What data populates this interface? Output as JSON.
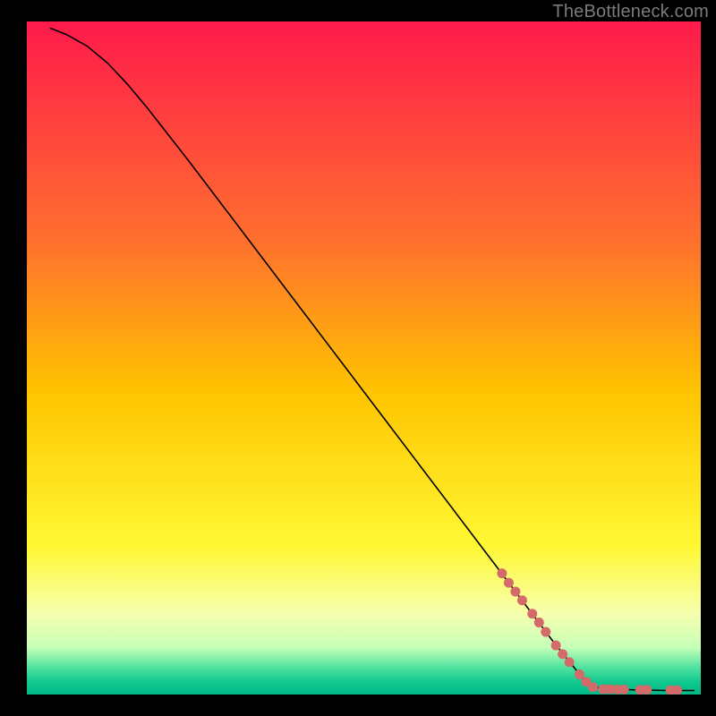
{
  "watermark": "TheBottleneck.com",
  "chart_data": {
    "type": "line",
    "title": "",
    "xlabel": "",
    "ylabel": "",
    "xlim": [
      0,
      100
    ],
    "ylim": [
      0,
      100
    ],
    "grid": false,
    "background_gradient": {
      "stops": [
        {
          "offset": 0.0,
          "color": "#ff1a4b"
        },
        {
          "offset": 0.32,
          "color": "#ff6e2f"
        },
        {
          "offset": 0.55,
          "color": "#ffc400"
        },
        {
          "offset": 0.78,
          "color": "#fff833"
        },
        {
          "offset": 0.88,
          "color": "#f7ffae"
        },
        {
          "offset": 0.93,
          "color": "#c6ffb8"
        },
        {
          "offset": 0.96,
          "color": "#4fe3a0"
        },
        {
          "offset": 0.98,
          "color": "#13c98f"
        },
        {
          "offset": 1.0,
          "color": "#00b888"
        }
      ]
    },
    "series": [
      {
        "name": "bottleneck-curve",
        "stroke": "#000000",
        "stroke_width": 1.6,
        "points": [
          {
            "x": 3.5,
            "y": 99.0
          },
          {
            "x": 6.0,
            "y": 98.0
          },
          {
            "x": 9.0,
            "y": 96.3
          },
          {
            "x": 12.0,
            "y": 93.8
          },
          {
            "x": 15.0,
            "y": 90.6
          },
          {
            "x": 18.0,
            "y": 87.0
          },
          {
            "x": 24.0,
            "y": 79.3
          },
          {
            "x": 30.0,
            "y": 71.4
          },
          {
            "x": 40.0,
            "y": 58.2
          },
          {
            "x": 50.0,
            "y": 45.0
          },
          {
            "x": 60.0,
            "y": 31.8
          },
          {
            "x": 70.0,
            "y": 18.6
          },
          {
            "x": 78.0,
            "y": 8.0
          },
          {
            "x": 82.5,
            "y": 2.4
          },
          {
            "x": 84.0,
            "y": 1.2
          },
          {
            "x": 86.0,
            "y": 0.8
          },
          {
            "x": 90.0,
            "y": 0.7
          },
          {
            "x": 95.0,
            "y": 0.6
          },
          {
            "x": 99.0,
            "y": 0.6
          }
        ]
      }
    ],
    "dotted_overlay": {
      "name": "highlighted-segment",
      "color": "#d46a6a",
      "radius": 5.5,
      "dots": [
        {
          "x": 70.5,
          "y": 18.0
        },
        {
          "x": 71.5,
          "y": 16.6
        },
        {
          "x": 72.5,
          "y": 15.3
        },
        {
          "x": 73.5,
          "y": 14.0
        },
        {
          "x": 75.0,
          "y": 12.0
        },
        {
          "x": 76.0,
          "y": 10.7
        },
        {
          "x": 77.0,
          "y": 9.3
        },
        {
          "x": 78.5,
          "y": 7.3
        },
        {
          "x": 79.5,
          "y": 6.0
        },
        {
          "x": 80.5,
          "y": 4.8
        },
        {
          "x": 82.0,
          "y": 3.0
        },
        {
          "x": 83.0,
          "y": 1.9
        },
        {
          "x": 84.0,
          "y": 1.1
        },
        {
          "x": 85.5,
          "y": 0.8
        },
        {
          "x": 86.5,
          "y": 0.8
        },
        {
          "x": 87.6,
          "y": 0.75
        },
        {
          "x": 88.6,
          "y": 0.75
        },
        {
          "x": 91.0,
          "y": 0.7
        },
        {
          "x": 92.0,
          "y": 0.7
        },
        {
          "x": 95.5,
          "y": 0.65
        },
        {
          "x": 96.5,
          "y": 0.65
        }
      ]
    }
  }
}
